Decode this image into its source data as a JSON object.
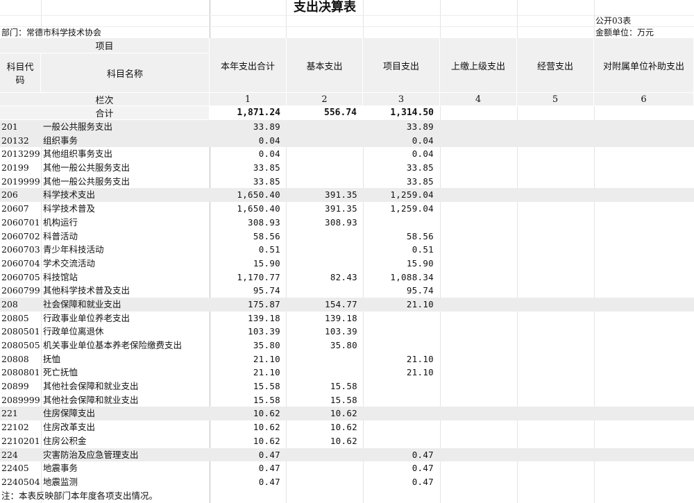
{
  "title": "支出决算表",
  "form_id": "公开03表",
  "unit": "金额单位：万元",
  "dept": "部门：常德市科学技术协会",
  "header": {
    "item": "项目",
    "code": "科目代码",
    "name": "科目名称",
    "cols": [
      "本年支出合计",
      "基本支出",
      "项目支出",
      "上缴上级支出",
      "经营支出",
      "对附属单位补助支出"
    ],
    "colnum_label": "栏次",
    "colnums": [
      "1",
      "2",
      "3",
      "4",
      "5",
      "6"
    ],
    "total_label": "合计",
    "totals": [
      "1,871.24",
      "556.74",
      "1,314.50"
    ]
  },
  "rows": [
    {
      "code": "201",
      "name": "一般公共服务支出",
      "v1": "33.89",
      "v2": "",
      "v3": "33.89",
      "band": true
    },
    {
      "code": "20132",
      "name": "组织事务",
      "v1": "0.04",
      "v2": "",
      "v3": "0.04",
      "band": true
    },
    {
      "code": "2013299",
      "name": "其他组织事务支出",
      "v1": "0.04",
      "v2": "",
      "v3": "0.04",
      "band": false
    },
    {
      "code": "20199",
      "name": "其他一般公共服务支出",
      "v1": "33.85",
      "v2": "",
      "v3": "33.85",
      "band": false
    },
    {
      "code": "2019999",
      "name": "其他一般公共服务支出",
      "v1": "33.85",
      "v2": "",
      "v3": "33.85",
      "band": false
    },
    {
      "code": "206",
      "name": "科学技术支出",
      "v1": "1,650.40",
      "v2": "391.35",
      "v3": "1,259.04",
      "band": true
    },
    {
      "code": "20607",
      "name": "科学技术普及",
      "v1": "1,650.40",
      "v2": "391.35",
      "v3": "1,259.04",
      "band": false
    },
    {
      "code": "2060701",
      "name": "机构运行",
      "v1": "308.93",
      "v2": "308.93",
      "v3": "",
      "band": false
    },
    {
      "code": "2060702",
      "name": "科普活动",
      "v1": "58.56",
      "v2": "",
      "v3": "58.56",
      "band": false
    },
    {
      "code": "2060703",
      "name": "青少年科技活动",
      "v1": "0.51",
      "v2": "",
      "v3": "0.51",
      "band": false
    },
    {
      "code": "2060704",
      "name": "学术交流活动",
      "v1": "15.90",
      "v2": "",
      "v3": "15.90",
      "band": false
    },
    {
      "code": "2060705",
      "name": "科技馆站",
      "v1": "1,170.77",
      "v2": "82.43",
      "v3": "1,088.34",
      "band": false
    },
    {
      "code": "2060799",
      "name": "其他科学技术普及支出",
      "v1": "95.74",
      "v2": "",
      "v3": "95.74",
      "band": false
    },
    {
      "code": "208",
      "name": "社会保障和就业支出",
      "v1": "175.87",
      "v2": "154.77",
      "v3": "21.10",
      "band": true
    },
    {
      "code": "20805",
      "name": "行政事业单位养老支出",
      "v1": "139.18",
      "v2": "139.18",
      "v3": "",
      "band": false
    },
    {
      "code": "2080501",
      "name": "行政单位离退休",
      "v1": "103.39",
      "v2": "103.39",
      "v3": "",
      "band": false
    },
    {
      "code": "2080505",
      "name": "机关事业单位基本养老保险缴费支出",
      "v1": "35.80",
      "v2": "35.80",
      "v3": "",
      "band": false
    },
    {
      "code": "20808",
      "name": "抚恤",
      "v1": "21.10",
      "v2": "",
      "v3": "21.10",
      "band": false
    },
    {
      "code": "2080801",
      "name": "死亡抚恤",
      "v1": "21.10",
      "v2": "",
      "v3": "21.10",
      "band": false
    },
    {
      "code": "20899",
      "name": "其他社会保障和就业支出",
      "v1": "15.58",
      "v2": "15.58",
      "v3": "",
      "band": false
    },
    {
      "code": "2089999",
      "name": "其他社会保障和就业支出",
      "v1": "15.58",
      "v2": "15.58",
      "v3": "",
      "band": false
    },
    {
      "code": "221",
      "name": "住房保障支出",
      "v1": "10.62",
      "v2": "10.62",
      "v3": "",
      "band": true
    },
    {
      "code": "22102",
      "name": "住房改革支出",
      "v1": "10.62",
      "v2": "10.62",
      "v3": "",
      "band": false
    },
    {
      "code": "2210201",
      "name": "住房公积金",
      "v1": "10.62",
      "v2": "10.62",
      "v3": "",
      "band": false
    },
    {
      "code": "224",
      "name": "灾害防治及应急管理支出",
      "v1": "0.47",
      "v2": "",
      "v3": "0.47",
      "band": true
    },
    {
      "code": "22405",
      "name": "地震事务",
      "v1": "0.47",
      "v2": "",
      "v3": "0.47",
      "band": false
    },
    {
      "code": "2240504",
      "name": "地震监测",
      "v1": "0.47",
      "v2": "",
      "v3": "0.47",
      "band": false
    }
  ],
  "note": "注：本表反映部门本年度各项支出情况。"
}
